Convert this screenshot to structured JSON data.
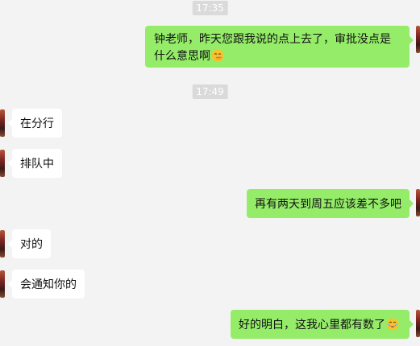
{
  "chat": {
    "messages": [
      {
        "type": "time",
        "text": "17:35"
      },
      {
        "type": "out",
        "text": "钟老师，昨天您跟我说的点上去了，审批没点是什么意思啊",
        "emoji": "face-with-hand-over-mouth"
      },
      {
        "type": "time",
        "text": "17:49"
      },
      {
        "type": "in",
        "text": "在分行"
      },
      {
        "type": "in",
        "text": "排队中"
      },
      {
        "type": "out",
        "text": "再有两天到周五应该差不多吧"
      },
      {
        "type": "in",
        "text": "对的"
      },
      {
        "type": "in",
        "text": "会通知你的"
      },
      {
        "type": "out",
        "text": "好的明白，这我心里都有数了",
        "emoji": "grinning-face"
      }
    ]
  },
  "colors": {
    "background": "#f3f3f3",
    "outgoing_bubble": "#95ec69",
    "incoming_bubble": "#ffffff",
    "timestamp_bg": "#dadada"
  }
}
